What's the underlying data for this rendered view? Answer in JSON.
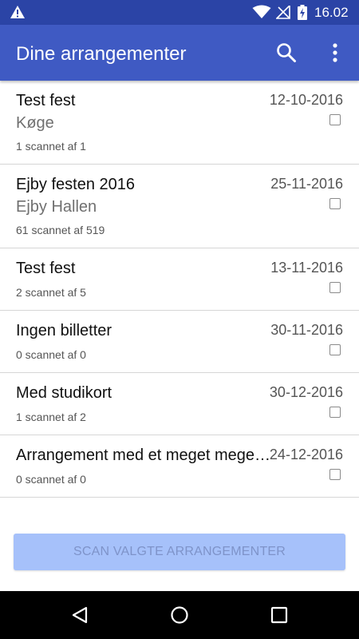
{
  "status_bar": {
    "time": "16.02",
    "icons": [
      "warning-icon",
      "wifi-icon",
      "no-signal-icon",
      "battery-charging-icon"
    ]
  },
  "app_bar": {
    "title": "Dine arrangementer",
    "icons": [
      "search-icon",
      "more-vert-icon"
    ]
  },
  "events": [
    {
      "name": "Test fest",
      "date": "12-10-2016",
      "location": "Køge",
      "scanned": "1 scannet af 1",
      "checked": false
    },
    {
      "name": "Ejby festen 2016",
      "date": "25-11-2016",
      "location": "Ejby Hallen",
      "scanned": "61 scannet af 519",
      "checked": false
    },
    {
      "name": "Test fest",
      "date": "13-11-2016",
      "location": "",
      "scanned": "2 scannet af 5",
      "checked": false
    },
    {
      "name": "Ingen billetter",
      "date": "30-11-2016",
      "location": "",
      "scanned": "0 scannet af 0",
      "checked": false
    },
    {
      "name": "Med studikort",
      "date": "30-12-2016",
      "location": "",
      "scanned": "1 scannet af 2",
      "checked": false
    },
    {
      "name": "Arrangement med et meget meget…",
      "date": "24-12-2016",
      "location": "",
      "scanned": "0 scannet af 0",
      "checked": false
    }
  ],
  "scan_button": {
    "label": "SCAN VALGTE ARRANGEMENTER",
    "enabled": false
  },
  "nav_bar": {
    "icons": [
      "back-icon",
      "home-icon",
      "recents-icon"
    ]
  },
  "colors": {
    "status_bar": "#2B44A6",
    "app_bar": "#3F5AC3",
    "button_disabled": "#A6C1FA",
    "button_text_disabled": "#7E93C9"
  }
}
